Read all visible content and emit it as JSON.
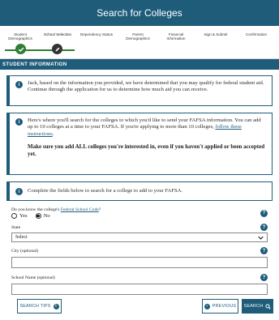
{
  "header": {
    "title": "Search for Colleges"
  },
  "steps": [
    {
      "label": "Student Demographics",
      "status": "completed"
    },
    {
      "label": "School Selection",
      "status": "current"
    },
    {
      "label": "Dependency Status",
      "status": "pending"
    },
    {
      "label": "Parent Demographics",
      "status": "pending"
    },
    {
      "label": "Financial Information",
      "status": "pending"
    },
    {
      "label": "Sign & Submit",
      "status": "pending"
    },
    {
      "label": "Confirmation",
      "status": "pending"
    }
  ],
  "section": {
    "title": "STUDENT INFORMATION"
  },
  "callouts": {
    "qualify": "Jack, based on the information you provided, we have determined that you may qualify for federal student aid. Continue through the application for us to determine how much aid you can receive.",
    "search_text": "Here's where you'll search for the colleges to which you'd like to send your FAFSA information. You can add up to 10 colleges at a time to your FAFSA. If you're applying to more than 10 colleges,",
    "search_link": "follow these instructions",
    "search_end": ".",
    "search_strong": "Make sure you add ALL colleges you're interested in, even if you haven't applied or been accepted yet.",
    "complete": "Complete the fields below to search for a college to add to your FAFSA."
  },
  "form": {
    "code_question_prefix": "Do you know the college's ",
    "code_question_link": "Federal School Code",
    "code_question_suffix": "?",
    "radio_yes": "Yes",
    "radio_no": "No",
    "selected": "No",
    "state_label": "State",
    "state_value": "Select",
    "city_label": "City (optional)",
    "city_value": "",
    "school_label": "School Name (optional)",
    "school_value": ""
  },
  "buttons": {
    "search_tips": "SEARCH TIPS",
    "previous": "PREVIOUS",
    "search": "SEARCH"
  },
  "colors": {
    "primary": "#1f5c7a",
    "success": "#2e7d32"
  }
}
